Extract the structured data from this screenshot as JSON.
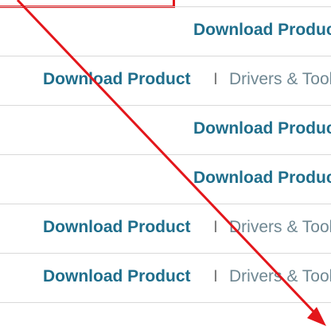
{
  "rows": [
    {
      "link": "Download Product",
      "separator": "",
      "secondary": ""
    },
    {
      "link": "Download Product",
      "separator": "I",
      "secondary": "Drivers & Tools"
    },
    {
      "link": "Download Product",
      "separator": "",
      "secondary": ""
    },
    {
      "link": "Download Product",
      "separator": "",
      "secondary": ""
    },
    {
      "link": "Download Product",
      "separator": "I",
      "secondary": "Drivers & Tools"
    },
    {
      "link": "Download Product",
      "separator": "I",
      "secondary": "Drivers & Tools"
    }
  ],
  "annotation": {
    "color": "#e3161b",
    "arrow_icon": "red-arrow-icon"
  }
}
